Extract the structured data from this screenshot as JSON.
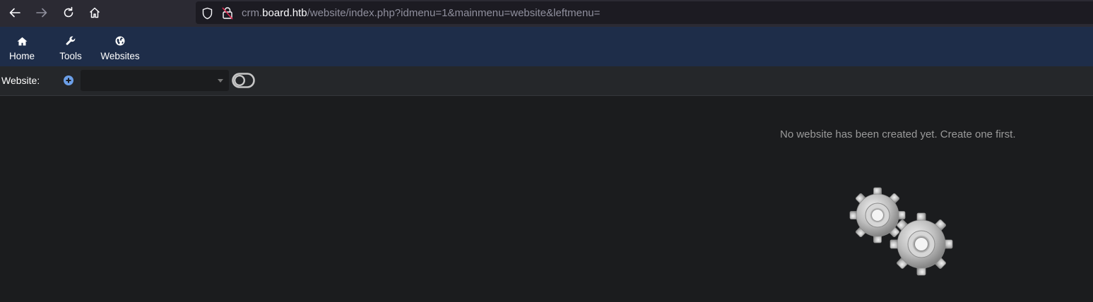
{
  "browser": {
    "url_prefix": "crm.",
    "url_host": "board.htb",
    "url_path": "/website/index.php?idmenu=1&mainmenu=website&leftmenu="
  },
  "top_menu": {
    "items": [
      {
        "label": "Home",
        "icon": "home-icon"
      },
      {
        "label": "Tools",
        "icon": "wrench-icon"
      },
      {
        "label": "Websites",
        "icon": "globe-icon"
      }
    ]
  },
  "website_toolbar": {
    "label": "Website:",
    "select_value": "",
    "add_icon": "plus-circle-icon",
    "toggle_icon": "toggle-icon"
  },
  "main": {
    "empty_message": "No website has been created yet. Create one first.",
    "illustration": "gears-icon"
  },
  "colors": {
    "browser_bg": "#2b2a33",
    "menu_bg": "#1e2d49",
    "toolbar_bg": "#25272a",
    "page_bg": "#1b1c1e",
    "accent_plus": "#6c9fe8"
  }
}
